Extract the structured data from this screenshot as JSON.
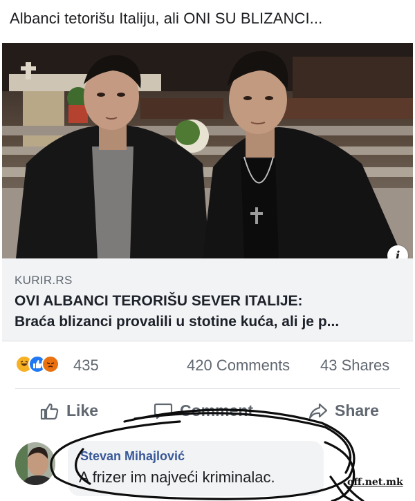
{
  "post": {
    "text": "Albanci tetorišu Italiju, ali ONI SU BLIZANCI..."
  },
  "link": {
    "domain": "KURIR.RS",
    "title": "OVI ALBANCI TERORIŠU SEVER ITALIJE:",
    "subtitle": "Braća blizanci provalili u stotine kuća, ali je p..."
  },
  "info_icon": "i",
  "stats": {
    "reaction_icons": [
      "haha-reaction-icon",
      "like-reaction-icon",
      "angry-reaction-icon"
    ],
    "reaction_count": "435",
    "comments": "420 Comments",
    "shares": "43 Shares"
  },
  "actions": {
    "like": "Like",
    "comment": "Comment",
    "share": "Share"
  },
  "comment": {
    "author": "Stevan Mihajlović",
    "text": "A frizer im najveći kriminalac."
  },
  "watermark": "off.net.mk",
  "colors": {
    "link_blue": "#385898",
    "muted_text": "#606770",
    "link_box_bg": "#f2f3f5",
    "like_blue": "#2078f4",
    "haha_yellow": "#f7b125",
    "angry_orange": "#e9710f"
  }
}
